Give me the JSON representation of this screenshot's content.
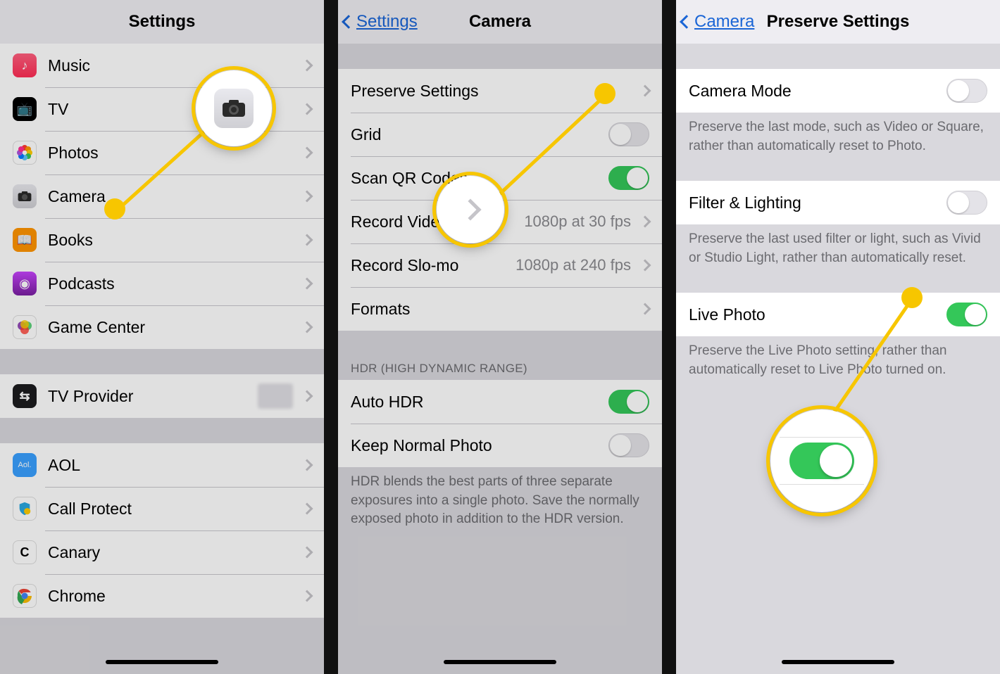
{
  "screen1": {
    "title": "Settings",
    "items": [
      {
        "label": "Music",
        "icon": "music"
      },
      {
        "label": "TV",
        "icon": "tv"
      },
      {
        "label": "Photos",
        "icon": "photos"
      },
      {
        "label": "Camera",
        "icon": "camera"
      },
      {
        "label": "Books",
        "icon": "books"
      },
      {
        "label": "Podcasts",
        "icon": "podcasts"
      },
      {
        "label": "Game Center",
        "icon": "gc"
      }
    ],
    "items2": [
      {
        "label": "TV Provider",
        "icon": "tvp"
      }
    ],
    "items3": [
      {
        "label": "AOL",
        "icon": "aol"
      },
      {
        "label": "Call Protect",
        "icon": "callp"
      },
      {
        "label": "Canary",
        "icon": "canary"
      },
      {
        "label": "Chrome",
        "icon": "chrome"
      }
    ]
  },
  "screen2": {
    "back": "Settings",
    "title": "Camera",
    "items": [
      {
        "label": "Preserve Settings",
        "type": "disclosure"
      },
      {
        "label": "Grid",
        "type": "toggle",
        "on": false
      },
      {
        "label": "Scan QR Codes",
        "type": "toggle",
        "on": true
      },
      {
        "label": "Record Video",
        "type": "value",
        "value": "1080p at 30 fps"
      },
      {
        "label": "Record Slo-mo",
        "type": "value",
        "value": "1080p at 240 fps"
      },
      {
        "label": "Formats",
        "type": "disclosure"
      }
    ],
    "hdr_header": "HDR (HIGH DYNAMIC RANGE)",
    "hdr_items": [
      {
        "label": "Auto HDR",
        "type": "toggle",
        "on": true
      },
      {
        "label": "Keep Normal Photo",
        "type": "toggle",
        "on": false
      }
    ],
    "hdr_footer": "HDR blends the best parts of three separate exposures into a single photo. Save the normally exposed photo in addition to the HDR version."
  },
  "screen3": {
    "back": "Camera",
    "title": "Preserve Settings",
    "sections": [
      {
        "label": "Camera Mode",
        "on": false,
        "footer": "Preserve the last mode, such as Video or Square, rather than automatically reset to Photo."
      },
      {
        "label": "Filter & Lighting",
        "on": false,
        "footer": "Preserve the last used filter or light, such as Vivid or Studio Light, rather than automatically reset."
      },
      {
        "label": "Live Photo",
        "on": true,
        "footer": "Preserve the Live Photo setting, rather than automatically reset to Live Photo turned on."
      }
    ]
  }
}
